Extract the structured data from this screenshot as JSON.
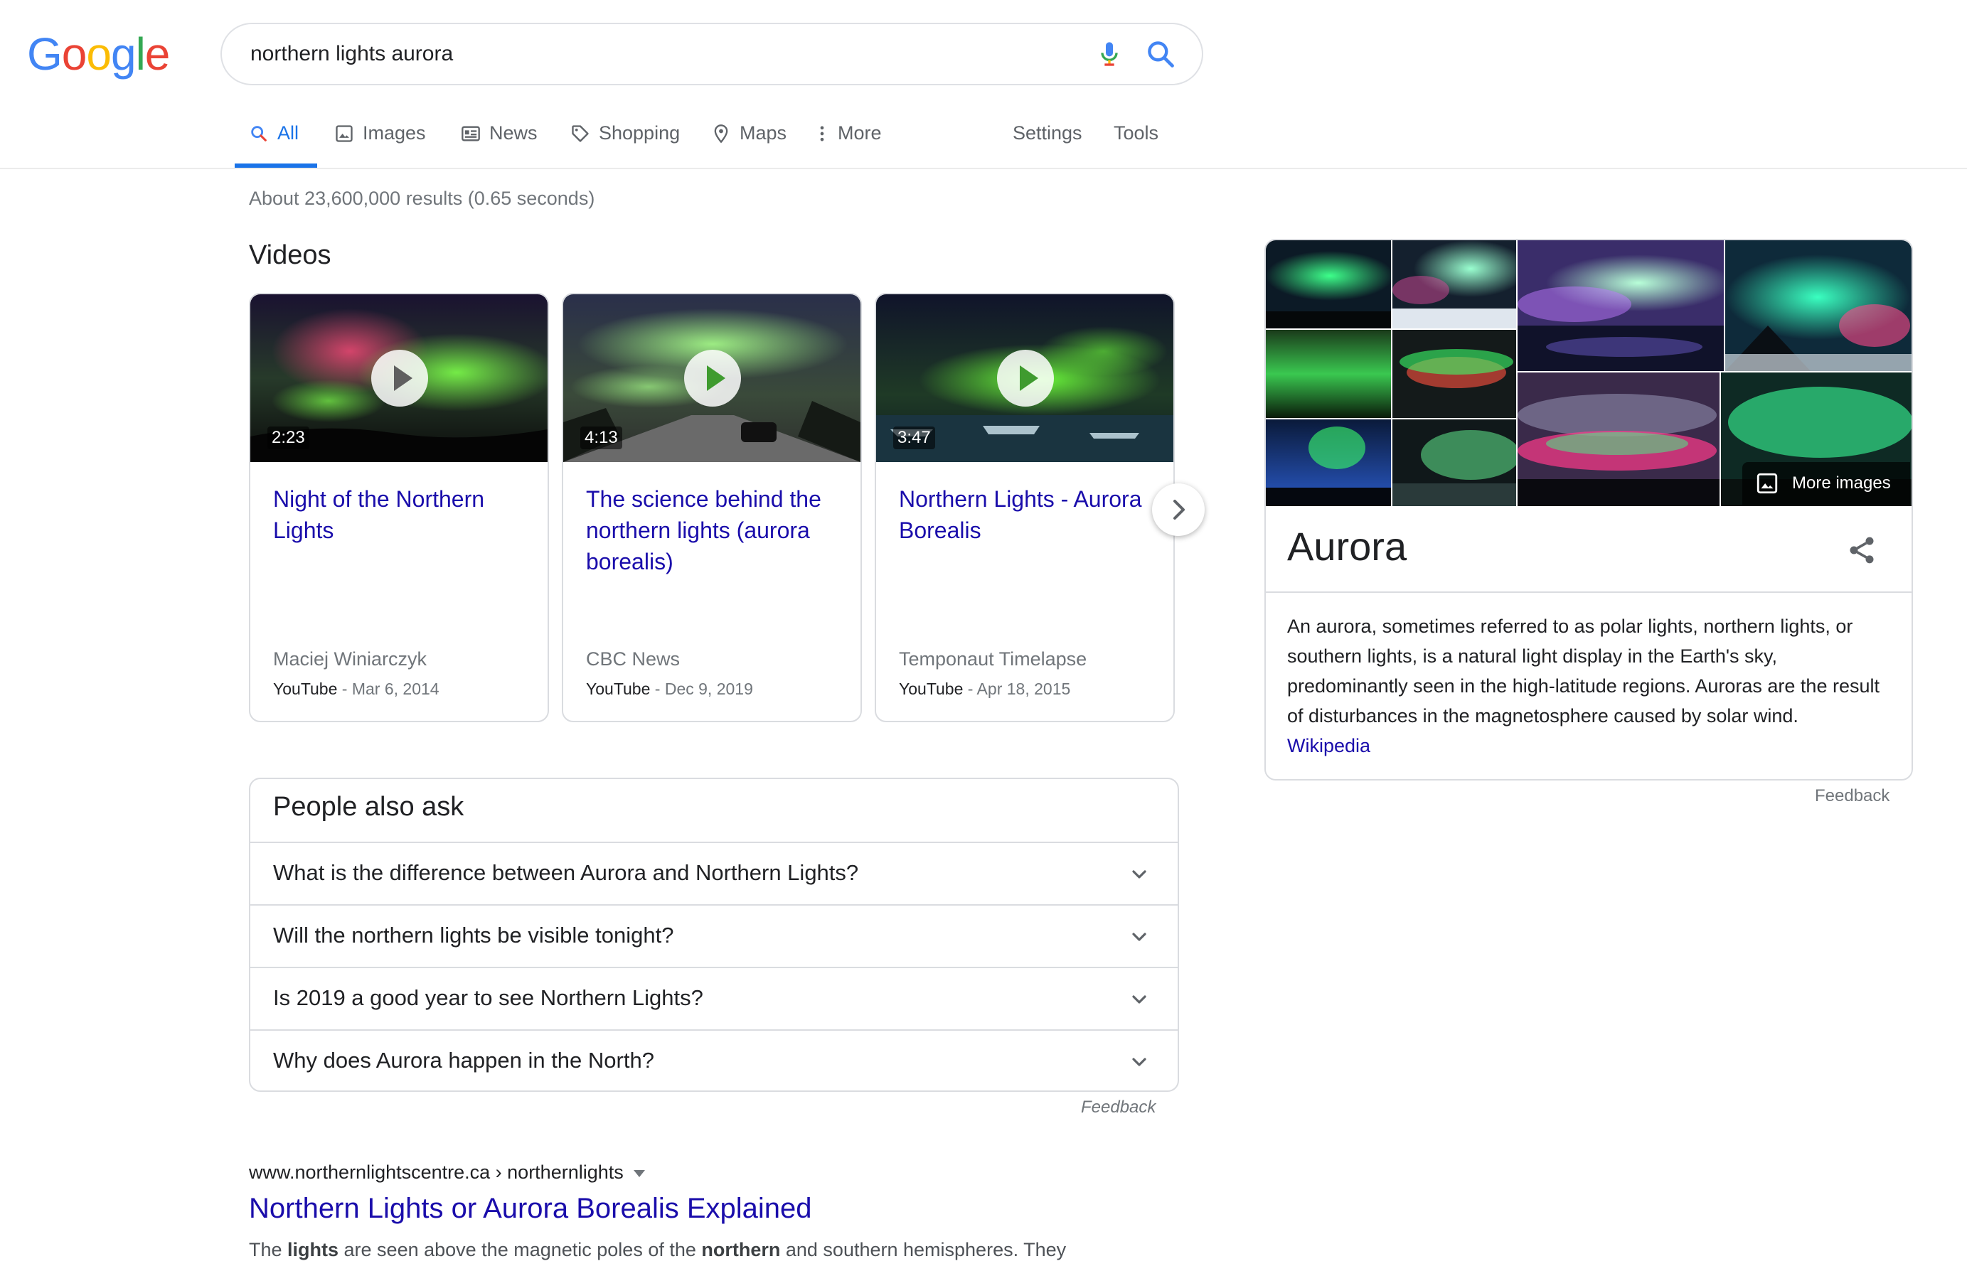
{
  "logo": {
    "text": "Google",
    "letters": [
      "G",
      "o",
      "o",
      "g",
      "l",
      "e"
    ],
    "colors": [
      "#4285f4",
      "#ea4335",
      "#fbbc05",
      "#4285f4",
      "#34a853",
      "#ea4335"
    ]
  },
  "search": {
    "query": "northern lights aurora",
    "placeholder": ""
  },
  "tabs": [
    {
      "label": "All",
      "icon": "search-icon",
      "active": true
    },
    {
      "label": "Images",
      "icon": "image-icon"
    },
    {
      "label": "News",
      "icon": "news-icon"
    },
    {
      "label": "Shopping",
      "icon": "tag-icon"
    },
    {
      "label": "Maps",
      "icon": "map-pin-icon"
    },
    {
      "label": "More",
      "icon": "more-vert-icon"
    },
    {
      "label": "Settings"
    },
    {
      "label": "Tools"
    }
  ],
  "stats": "About 23,600,000 results (0.65 seconds)",
  "videos": {
    "title": "Videos",
    "items": [
      {
        "duration": "2:23",
        "title": "Night of the Northern Lights",
        "channel": "Maciej Winiarczyk",
        "source": "YouTube",
        "date": " - Mar 6, 2014"
      },
      {
        "duration": "4:13",
        "title": "The science behind the northern lights (aurora borealis)",
        "channel": "CBC News",
        "source": "YouTube",
        "date": " - Dec 9, 2019"
      },
      {
        "duration": "3:47",
        "title": "Northern Lights - Aurora Borealis",
        "channel": "Temponaut Timelapse",
        "source": "YouTube",
        "date": " - Apr 18, 2015"
      }
    ]
  },
  "paa": {
    "title": "People also ask",
    "questions": [
      "What is the difference between Aurora and Northern Lights?",
      "Will the northern lights be visible tonight?",
      "Is 2019 a good year to see Northern Lights?",
      "Why does Aurora happen in the North?"
    ],
    "feedback": "Feedback"
  },
  "result": {
    "cite": "www.northernlightscentre.ca › northernlights",
    "title": "Northern Lights or Aurora Borealis Explained",
    "snippet_parts": [
      "The ",
      "lights",
      " are seen above the magnetic poles of the ",
      "northern",
      " and southern hemispheres. They"
    ]
  },
  "knowledge_panel": {
    "title": "Aurora",
    "more_images": "More images",
    "description": "An aurora, sometimes referred to as polar lights, northern lights, or southern lights, is a natural light display in the Earth's sky, predominantly seen in the high-latitude regions. Auroras are the result of disturbances in the magnetosphere caused by solar wind.",
    "source_link": "Wikipedia",
    "feedback": "Feedback"
  },
  "colors": {
    "link": "#1a0dab",
    "accent": "#1a73e8",
    "border": "#dadce0",
    "muted": "#70757a"
  }
}
